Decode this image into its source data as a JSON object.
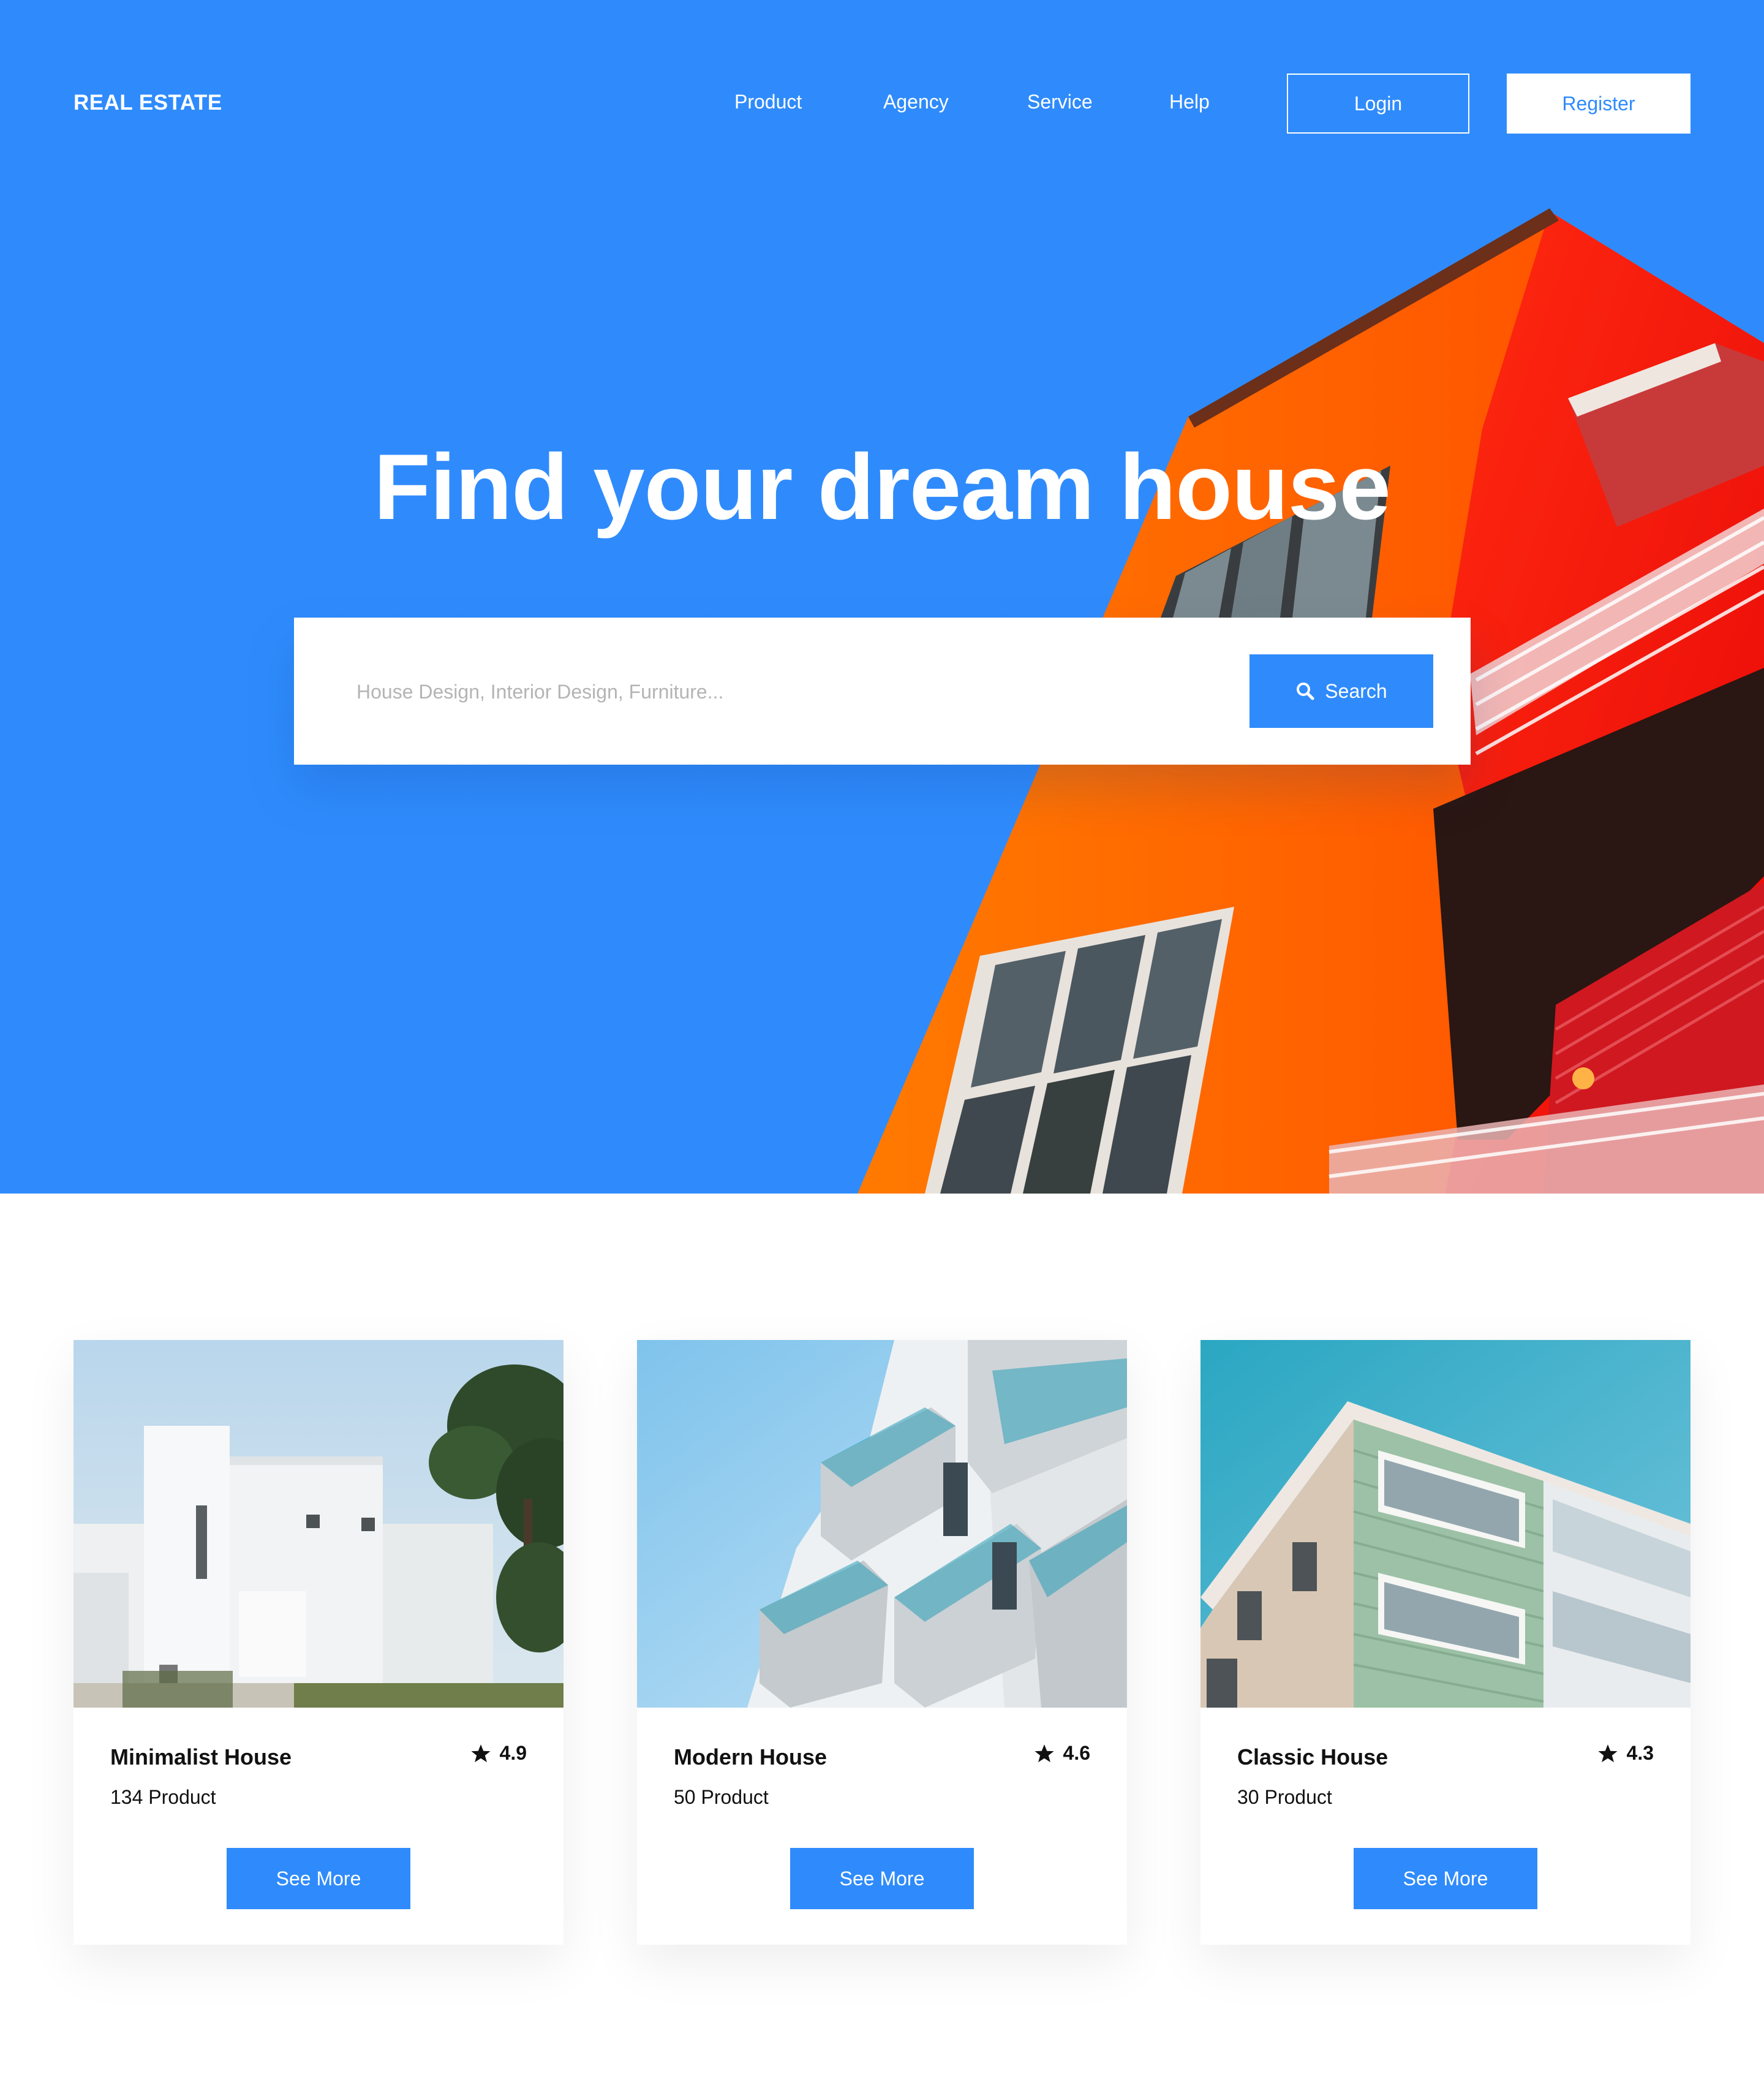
{
  "brand": "REAL ESTATE",
  "nav": {
    "items": [
      {
        "label": "Product"
      },
      {
        "label": "Agency"
      },
      {
        "label": "Service"
      },
      {
        "label": "Help"
      }
    ],
    "login_label": "Login",
    "register_label": "Register"
  },
  "hero": {
    "title": "Find your dream house",
    "search": {
      "placeholder": "House Design, Interior Design, Furniture...",
      "button_label": "Search",
      "button_icon": "search-icon"
    }
  },
  "cards": [
    {
      "title": "Minimalist House",
      "rating": "4.9",
      "count": "134 Product",
      "button_label": "See More",
      "image": "white-minimalist-house-photo"
    },
    {
      "title": "Modern House",
      "rating": "4.6",
      "count": "50 Product",
      "button_label": "See More",
      "image": "modern-building-balconies-photo"
    },
    {
      "title": "Classic House",
      "rating": "4.3",
      "count": "30 Product",
      "button_label": "See More",
      "image": "classic-green-building-photo"
    }
  ],
  "colors": {
    "primary": "#2f8bfc",
    "building_orange": "#ff6a00",
    "building_red": "#ff1a10",
    "text": "#111111",
    "placeholder": "#b4b4b4"
  }
}
